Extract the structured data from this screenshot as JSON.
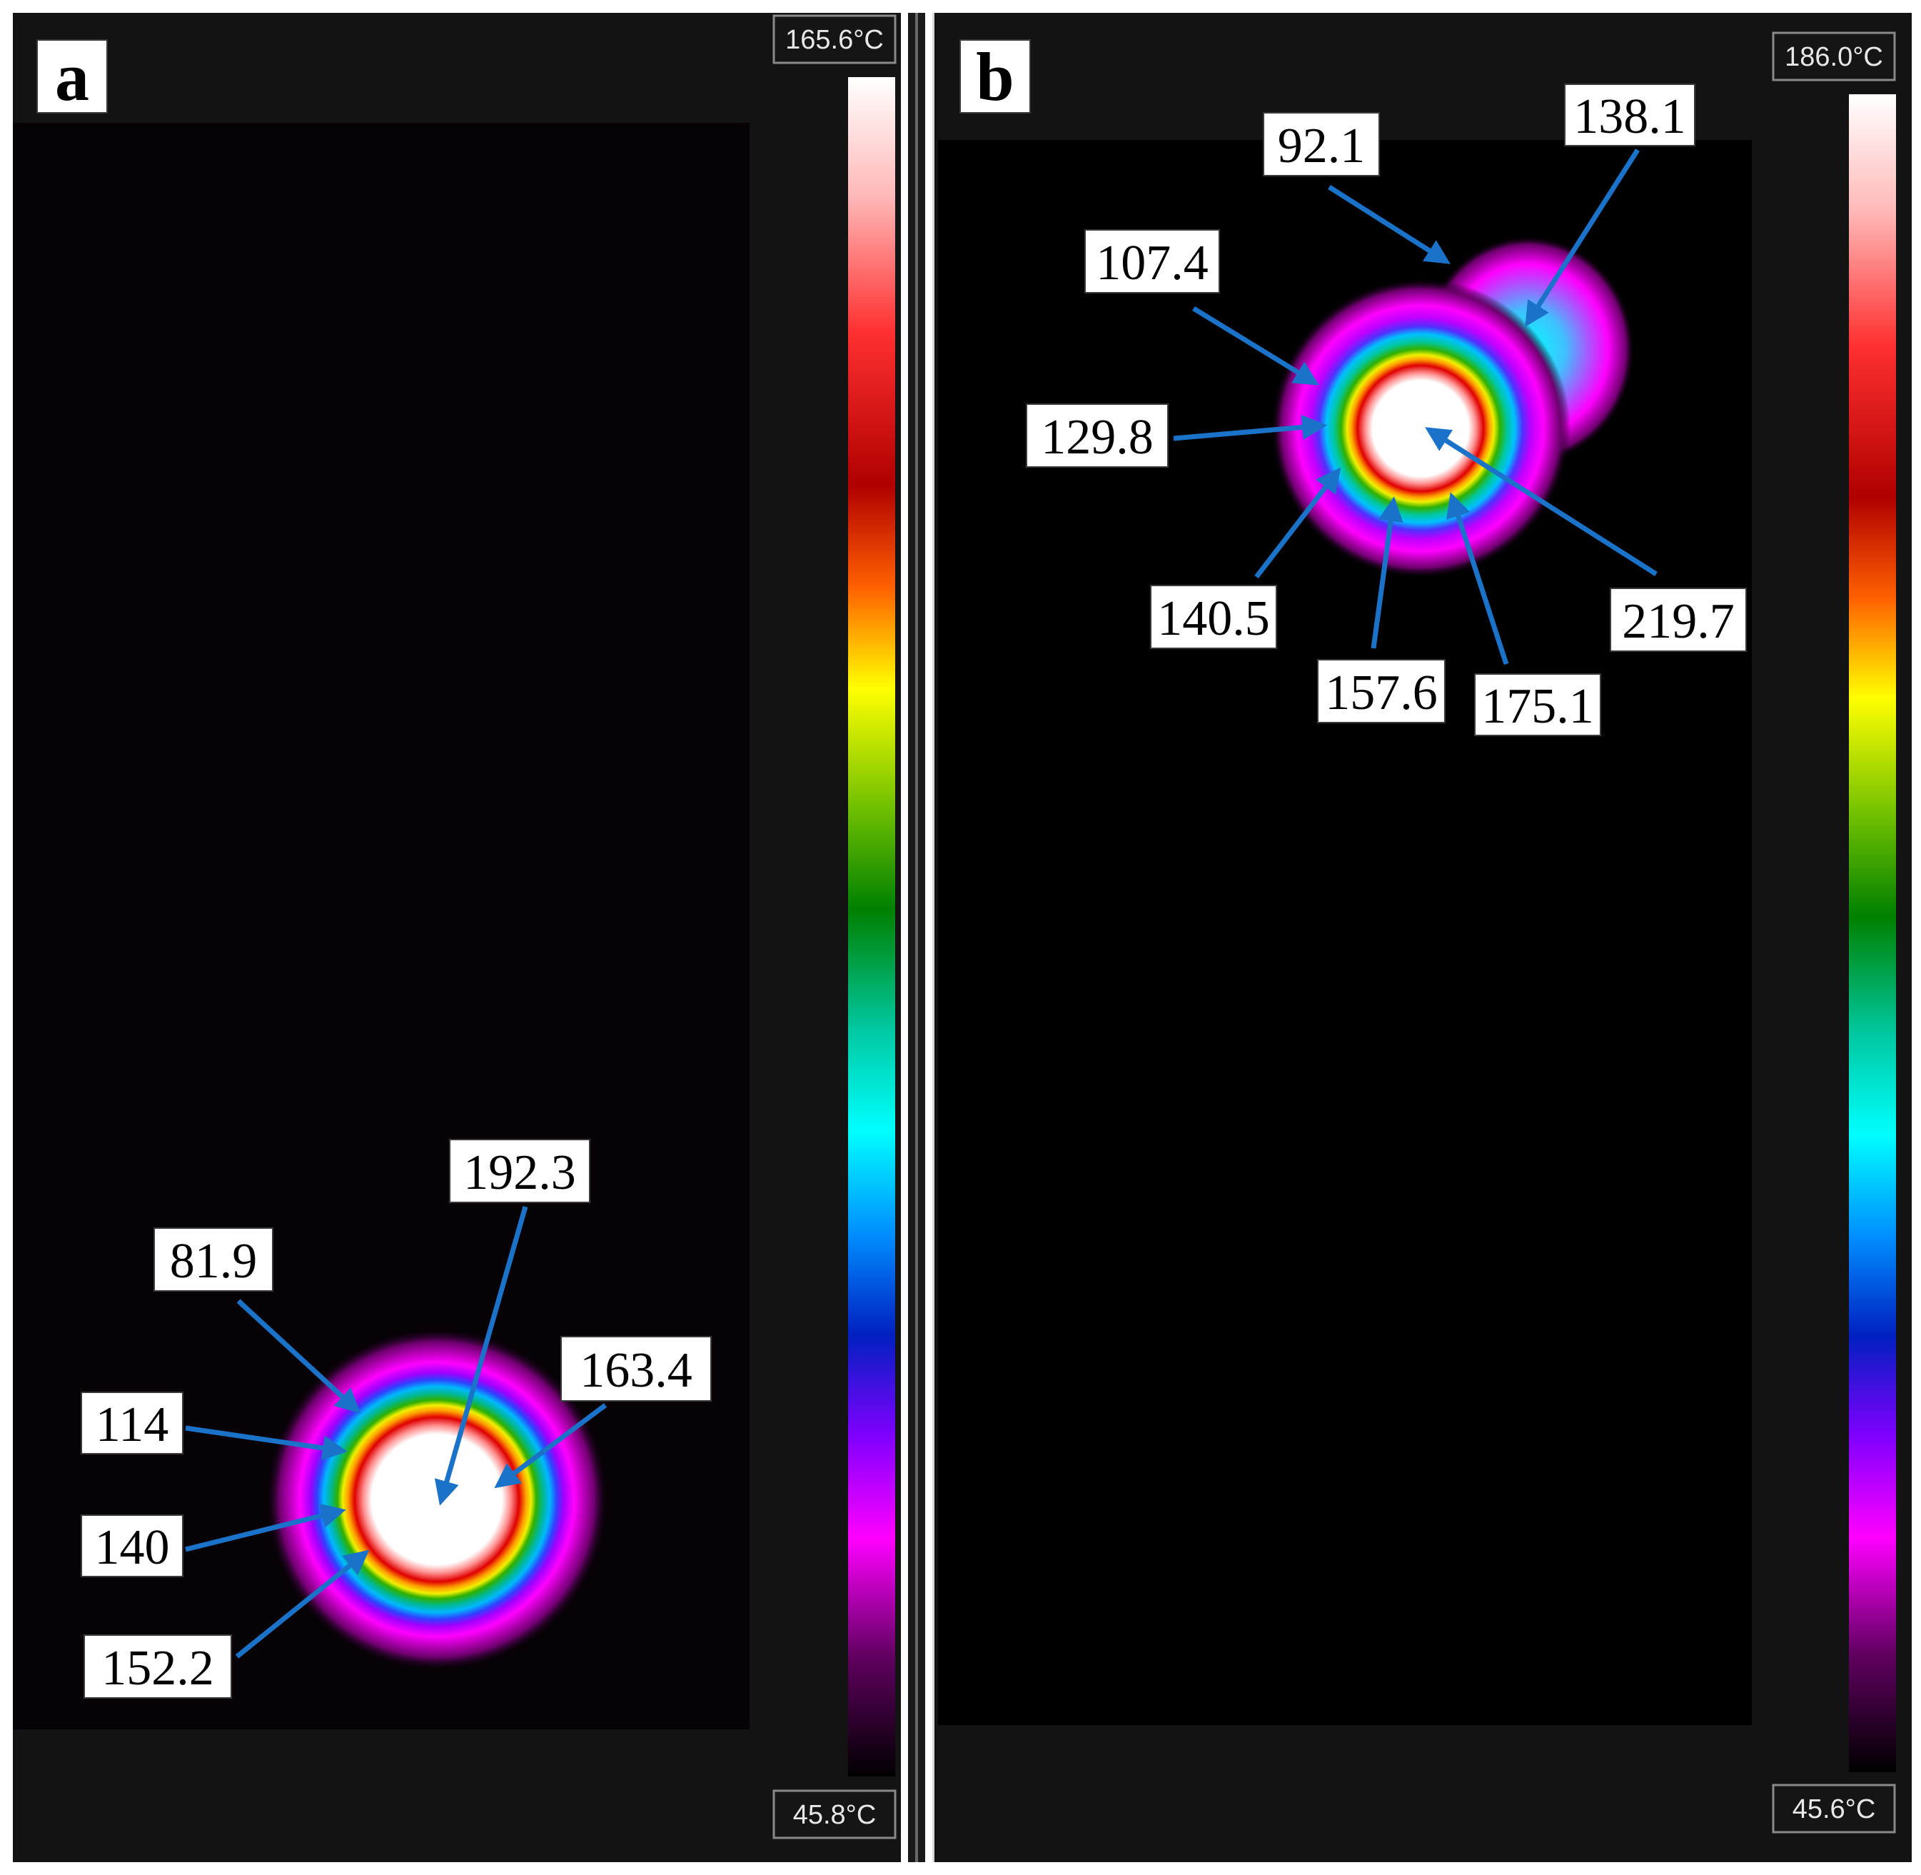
{
  "colors": {
    "arrow": "#1a73c8",
    "palette": [
      "#000000",
      "#5a0060",
      "#ff00ff",
      "#7a00ff",
      "#0018c8",
      "#0088ff",
      "#00ffff",
      "#00c8a0",
      "#00a000",
      "#90d000",
      "#ffff00",
      "#ffa000",
      "#ff5000",
      "#c80000",
      "#ff3030",
      "#ffb0b0",
      "#ffffff"
    ]
  },
  "panels": [
    {
      "id": "a",
      "letter": "a",
      "scale_max": "165.6°C",
      "scale_min": "45.8°C",
      "labels": [
        {
          "text": "192.3"
        },
        {
          "text": "81.9"
        },
        {
          "text": "163.4"
        },
        {
          "text": "114"
        },
        {
          "text": "140"
        },
        {
          "text": "152.2"
        }
      ]
    },
    {
      "id": "b",
      "letter": "b",
      "scale_max": "186.0°C",
      "scale_min": "45.6°C",
      "labels": [
        {
          "text": "92.1"
        },
        {
          "text": "138.1"
        },
        {
          "text": "107.4"
        },
        {
          "text": "129.8"
        },
        {
          "text": "140.5"
        },
        {
          "text": "157.6"
        },
        {
          "text": "175.1"
        },
        {
          "text": "219.7"
        }
      ]
    }
  ]
}
